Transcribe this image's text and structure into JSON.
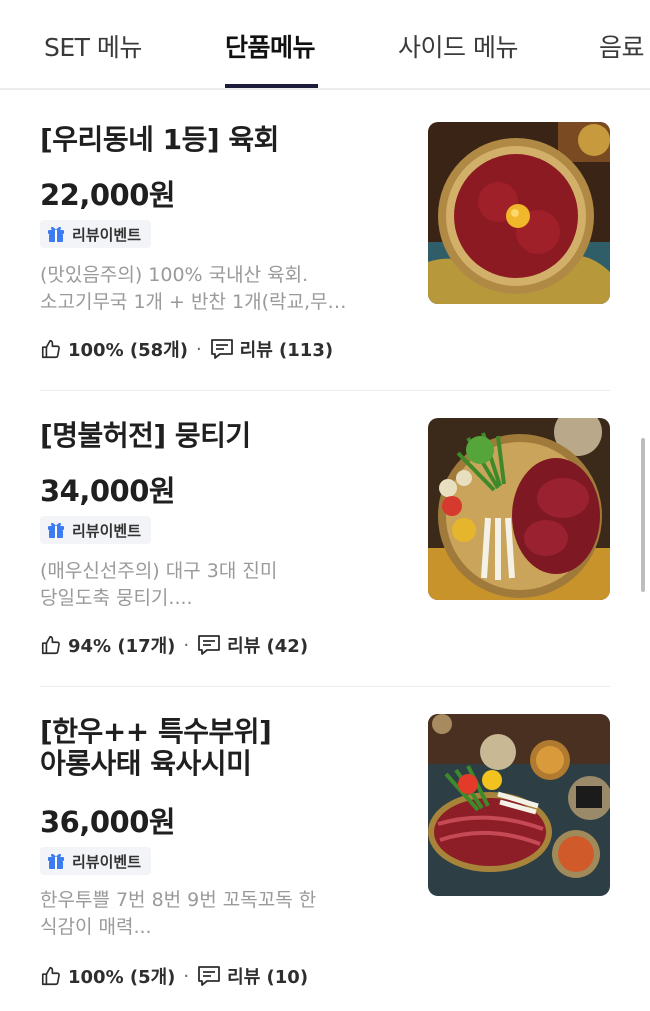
{
  "tabs": [
    {
      "label": "SET 메뉴"
    },
    {
      "label": "단품메뉴"
    },
    {
      "label": "사이드 메뉴"
    },
    {
      "label": "음료"
    }
  ],
  "items": [
    {
      "title_lines": [
        "[우리동네 1등] 육회"
      ],
      "price": "22,000원",
      "badge": "리뷰이벤트",
      "desc_lines": [
        "(맛있음주의) 100% 국내산 육회.",
        "소고기무국 1개 + 반찬 1개(락교,무…"
      ],
      "like": "100% (58개)",
      "review": "리뷰 (113)"
    },
    {
      "title_lines": [
        "[명불허전] 뭉티기"
      ],
      "price": "34,000원",
      "badge": "리뷰이벤트",
      "desc_lines": [
        "(매우신선주의) 대구 3대 진미",
        "당일도축 뭉티기...."
      ],
      "like": "94% (17개)",
      "review": "리뷰 (42)"
    },
    {
      "title_lines": [
        "[한우++ 특수부위]",
        "아롱사태 육사시미"
      ],
      "price": "36,000원",
      "badge": "리뷰이벤트",
      "desc_lines": [
        "한우투쁠 7번 8번 9번 꼬독꼬독 한",
        "식감이 매력..."
      ],
      "like": "100% (5개)",
      "review": "리뷰 (10)"
    }
  ],
  "colors": {
    "accent_underline": "#1c1c3a",
    "muted_text": "#9a9a9a",
    "badge_bg": "#f3f4f7",
    "gift_icon": "#3d7bf0"
  },
  "icons": [
    "gift-icon",
    "thumbs-up-icon",
    "comment-icon"
  ]
}
